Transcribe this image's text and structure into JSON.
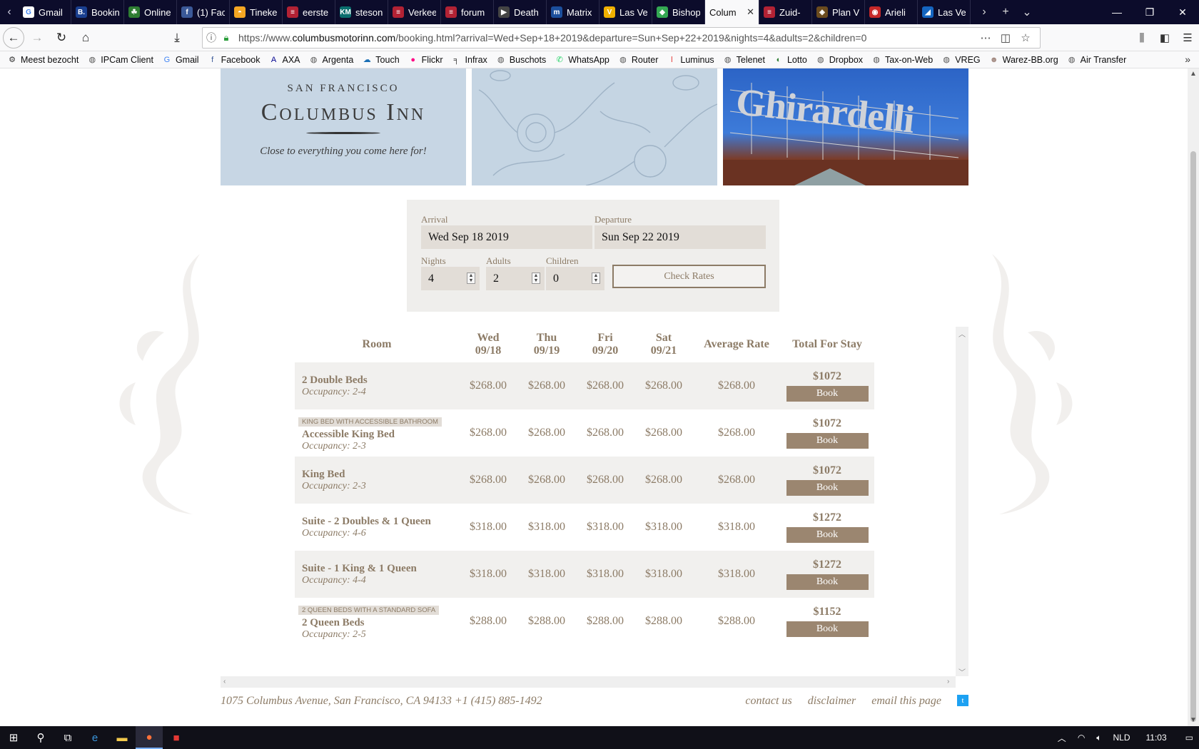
{
  "browser": {
    "tabs": [
      {
        "label": "Gmail",
        "color": "#ffffff",
        "glyph": "G",
        "glyph_color": "#4285f4"
      },
      {
        "label": "Bookin",
        "color": "#1a3f8f",
        "glyph": "B."
      },
      {
        "label": "Online",
        "color": "#2e7d32",
        "glyph": "☘"
      },
      {
        "label": "(1) Fac",
        "color": "#3b5998",
        "glyph": "f"
      },
      {
        "label": "Tineke",
        "color": "#f5a623",
        "glyph": "◓"
      },
      {
        "label": "eerste",
        "color": "#b22234",
        "glyph": "≡"
      },
      {
        "label": "steson",
        "color": "#0a6e6e",
        "glyph": "KM"
      },
      {
        "label": "Verkee",
        "color": "#b22234",
        "glyph": "≡"
      },
      {
        "label": "forum",
        "color": "#b22234",
        "glyph": "≡"
      },
      {
        "label": "Death",
        "color": "#444444",
        "glyph": "▶"
      },
      {
        "label": "Matrix",
        "color": "#1c4f9c",
        "glyph": "m"
      },
      {
        "label": "Las Ve",
        "color": "#f0b000",
        "glyph": "V"
      },
      {
        "label": "Bishop",
        "color": "#34a853",
        "glyph": "◆"
      },
      {
        "label": "Colum",
        "color": "#ffffff",
        "glyph": "",
        "active": true
      },
      {
        "label": "Zuid-",
        "color": "#b22234",
        "glyph": "≡"
      },
      {
        "label": "Plan V",
        "color": "#6b4b1e",
        "glyph": "◈"
      },
      {
        "label": "Arieli",
        "color": "#c62828",
        "glyph": "◉"
      },
      {
        "label": "Las Ve",
        "color": "#1565c0",
        "glyph": "◢"
      }
    ],
    "url": "https://www.columbusmotorinn.com/booking.html?arrival=Wed+Sep+18+2019&departure=Sun+Sep+22+2019&nights=4&adults=2&children=0",
    "url_domain": "columbusmotorinn.com",
    "bookmarks": [
      {
        "label": "Meest bezocht",
        "icon": "⚙",
        "color": "#333333"
      },
      {
        "label": "IPCam Client",
        "icon": "◍",
        "color": "#555555"
      },
      {
        "label": "Gmail",
        "icon": "G",
        "color": "#4285f4"
      },
      {
        "label": "Facebook",
        "icon": "f",
        "color": "#3b5998"
      },
      {
        "label": "AXA",
        "icon": "A",
        "color": "#00008f"
      },
      {
        "label": "Argenta",
        "icon": "◍",
        "color": "#555555"
      },
      {
        "label": "Touch",
        "icon": "☁",
        "color": "#1a6fb5"
      },
      {
        "label": "Flickr",
        "icon": "●",
        "color": "#ff0084"
      },
      {
        "label": "Infrax",
        "icon": "╕",
        "color": "#333333"
      },
      {
        "label": "Buschots",
        "icon": "◍",
        "color": "#555555"
      },
      {
        "label": "WhatsApp",
        "icon": "✆",
        "color": "#25d366"
      },
      {
        "label": "Router",
        "icon": "◍",
        "color": "#555555"
      },
      {
        "label": "Luminus",
        "icon": "l",
        "color": "#e53935"
      },
      {
        "label": "Telenet",
        "icon": "◍",
        "color": "#555555"
      },
      {
        "label": "Lotto",
        "icon": "◐",
        "color": "#2e7d32"
      },
      {
        "label": "Dropbox",
        "icon": "◍",
        "color": "#555555"
      },
      {
        "label": "Tax-on-Web",
        "icon": "◍",
        "color": "#555555"
      },
      {
        "label": "VREG",
        "icon": "◍",
        "color": "#555555"
      },
      {
        "label": "Warez-BB.org",
        "icon": "☻",
        "color": "#a1887f"
      },
      {
        "label": "Air Transfer",
        "icon": "◍",
        "color": "#555555"
      }
    ]
  },
  "header": {
    "city": "SAN FRANCISCO",
    "name": "Columbus Inn",
    "tagline": "Close to everything you come here for!",
    "sign_text": "Ghirardelli"
  },
  "form": {
    "arrival_label": "Arrival",
    "arrival_value": "Wed Sep 18 2019",
    "departure_label": "Departure",
    "departure_value": "Sun Sep 22 2019",
    "nights_label": "Nights",
    "nights_value": "4",
    "adults_label": "Adults",
    "adults_value": "2",
    "children_label": "Children",
    "children_value": "0",
    "check_button": "Check Rates"
  },
  "rates": {
    "headers": {
      "room": "Room",
      "days": [
        {
          "day": "Wed",
          "date": "09/18"
        },
        {
          "day": "Thu",
          "date": "09/19"
        },
        {
          "day": "Fri",
          "date": "09/20"
        },
        {
          "day": "Sat",
          "date": "09/21"
        }
      ],
      "avg": "Average Rate",
      "total": "Total For Stay"
    },
    "book_label": "Book",
    "rows": [
      {
        "badge": "",
        "name": "2 Double Beds",
        "occupancy": "Occupancy: 2-4",
        "nightly": [
          "$268.00",
          "$268.00",
          "$268.00",
          "$268.00"
        ],
        "avg": "$268.00",
        "total": "$1072"
      },
      {
        "badge": "KING BED WITH ACCESSIBLE BATHROOM",
        "name": "Accessible King Bed",
        "occupancy": "Occupancy: 2-3",
        "nightly": [
          "$268.00",
          "$268.00",
          "$268.00",
          "$268.00"
        ],
        "avg": "$268.00",
        "total": "$1072"
      },
      {
        "badge": "",
        "name": "King Bed",
        "occupancy": "Occupancy: 2-3",
        "nightly": [
          "$268.00",
          "$268.00",
          "$268.00",
          "$268.00"
        ],
        "avg": "$268.00",
        "total": "$1072"
      },
      {
        "badge": "",
        "name": "Suite - 2 Doubles & 1 Queen",
        "occupancy": "Occupancy: 4-6",
        "nightly": [
          "$318.00",
          "$318.00",
          "$318.00",
          "$318.00"
        ],
        "avg": "$318.00",
        "total": "$1272"
      },
      {
        "badge": "",
        "name": "Suite - 1 King & 1 Queen",
        "occupancy": "Occupancy: 4-4",
        "nightly": [
          "$318.00",
          "$318.00",
          "$318.00",
          "$318.00"
        ],
        "avg": "$318.00",
        "total": "$1272"
      },
      {
        "badge": "2 QUEEN BEDS WITH A STANDARD SOFA",
        "name": "2 Queen Beds",
        "occupancy": "Occupancy: 2-5",
        "nightly": [
          "$288.00",
          "$288.00",
          "$288.00",
          "$288.00"
        ],
        "avg": "$288.00",
        "total": "$1152"
      }
    ]
  },
  "footer": {
    "address": "1075 Columbus Avenue, San Francisco, CA 94133 +1 (415) 885-1492",
    "links": [
      "contact us",
      "disclaimer",
      "email this page"
    ]
  },
  "taskbar": {
    "language": "NLD",
    "time": "11:03"
  }
}
